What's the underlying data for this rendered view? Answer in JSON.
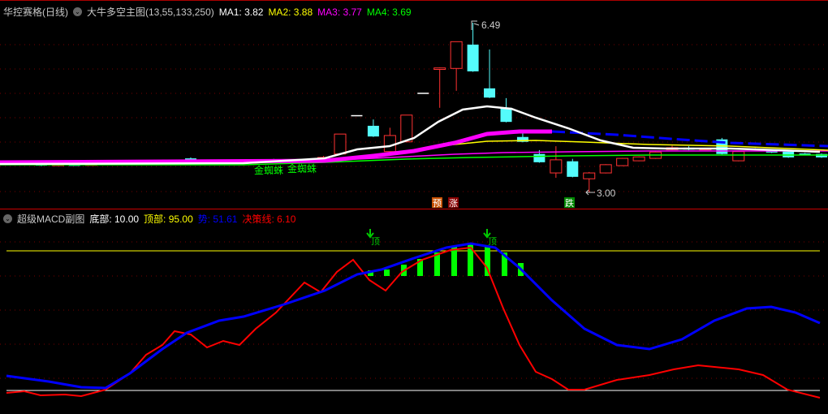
{
  "main_header": {
    "stock": "华控赛格(日线)",
    "indicator": "大牛多空主图(13,55,133,250)",
    "ma": [
      {
        "label": "MA1: 3.82",
        "color": "#ffffff"
      },
      {
        "label": "MA2: 3.88",
        "color": "#ffff00"
      },
      {
        "label": "MA3: 3.77",
        "color": "#ff00ff"
      },
      {
        "label": "MA4: 3.69",
        "color": "#00ff00"
      }
    ]
  },
  "sub_header": {
    "indicator": "超级MACD副图",
    "items": [
      {
        "label": "底部: 10.00",
        "color": "#ffffff"
      },
      {
        "label": "顶部: 95.00",
        "color": "#ffff00"
      },
      {
        "label": "势: 51.61",
        "color": "#0000ff"
      },
      {
        "label": "决策线: 6.10",
        "color": "#ff0000"
      }
    ]
  },
  "annotations": {
    "high": "6.49",
    "low": "3.00",
    "spider1": "金蜘蛛",
    "spider2": "金蜘蛛",
    "pre": "预",
    "up": "涨",
    "down": "跌",
    "top1": "顶",
    "top2": "顶"
  },
  "colors": {
    "up": "#ff3232",
    "down": "#54fcfc",
    "accent": "#ffff00"
  },
  "chart_data": {
    "type": "candlestick",
    "candles": [
      [
        3.65,
        3.62,
        3.66,
        3.61
      ],
      [
        3.6,
        3.62,
        3.63,
        3.59
      ],
      [
        3.62,
        3.55,
        3.63,
        3.54
      ],
      [
        3.55,
        3.58,
        3.59,
        3.54
      ],
      [
        3.57,
        3.56,
        3.58,
        3.55
      ],
      [
        3.56,
        3.58,
        3.59,
        3.55
      ],
      [
        3.58,
        3.6,
        3.61,
        3.57
      ],
      [
        3.61,
        3.62,
        3.63,
        3.6
      ],
      [
        3.62,
        3.61,
        3.63,
        3.6
      ],
      [
        3.61,
        3.62,
        3.63,
        3.6
      ],
      [
        3.62,
        3.62,
        3.63,
        3.61
      ],
      [
        3.7,
        3.64,
        3.72,
        3.63
      ],
      [
        3.62,
        3.61,
        3.63,
        3.6
      ],
      [
        3.61,
        3.62,
        3.63,
        3.6
      ],
      [
        3.62,
        3.62,
        3.63,
        3.61
      ],
      [
        3.62,
        3.65,
        3.66,
        3.61
      ],
      [
        3.66,
        3.65,
        3.69,
        3.64
      ],
      [
        3.62,
        3.66,
        3.67,
        3.61
      ],
      [
        3.66,
        3.68,
        3.69,
        3.65
      ],
      [
        3.68,
        3.72,
        3.75,
        3.67
      ],
      [
        3.79,
        4.2,
        4.2,
        3.79
      ],
      [
        4.59,
        4.59,
        4.59,
        4.59
      ],
      [
        4.37,
        4.15,
        4.5,
        4.14
      ],
      [
        3.84,
        4.17,
        4.33,
        3.8
      ],
      [
        4.04,
        4.59,
        4.59,
        4.03
      ],
      [
        5.05,
        5.05,
        5.05,
        5.05
      ],
      [
        5.53,
        5.56,
        5.57,
        4.74
      ],
      [
        5.55,
        6.1,
        6.1,
        5.09
      ],
      [
        6.04,
        5.49,
        6.49,
        5.48
      ],
      [
        5.14,
        4.95,
        5.94,
        4.94
      ],
      [
        4.74,
        4.45,
        4.94,
        4.44
      ],
      [
        4.14,
        4.04,
        4.27,
        4.03
      ],
      [
        3.79,
        3.62,
        3.87,
        3.61
      ],
      [
        3.4,
        3.67,
        3.95,
        3.3
      ],
      [
        3.64,
        3.32,
        3.69,
        3.31
      ],
      [
        3.28,
        3.4,
        3.42,
        3.0
      ],
      [
        3.4,
        3.57,
        3.58,
        3.39
      ],
      [
        3.55,
        3.7,
        3.71,
        3.54
      ],
      [
        3.65,
        3.73,
        3.74,
        3.64
      ],
      [
        3.7,
        3.83,
        3.84,
        3.69
      ],
      [
        3.88,
        3.92,
        3.96,
        3.87
      ],
      [
        3.92,
        3.88,
        3.95,
        3.87
      ],
      [
        3.88,
        3.9,
        3.91,
        3.87
      ],
      [
        4.09,
        3.79,
        4.12,
        3.78
      ],
      [
        3.65,
        3.84,
        3.85,
        3.64
      ],
      [
        3.9,
        3.88,
        3.91,
        3.87
      ],
      [
        3.88,
        3.82,
        3.89,
        3.81
      ],
      [
        3.84,
        3.72,
        3.85,
        3.71
      ],
      [
        3.8,
        3.78,
        3.81,
        3.77
      ],
      [
        3.79,
        3.72,
        3.8,
        3.71
      ]
    ],
    "highlight": [
      15,
      17
    ],
    "ylim": [
      3.0,
      6.49
    ]
  }
}
